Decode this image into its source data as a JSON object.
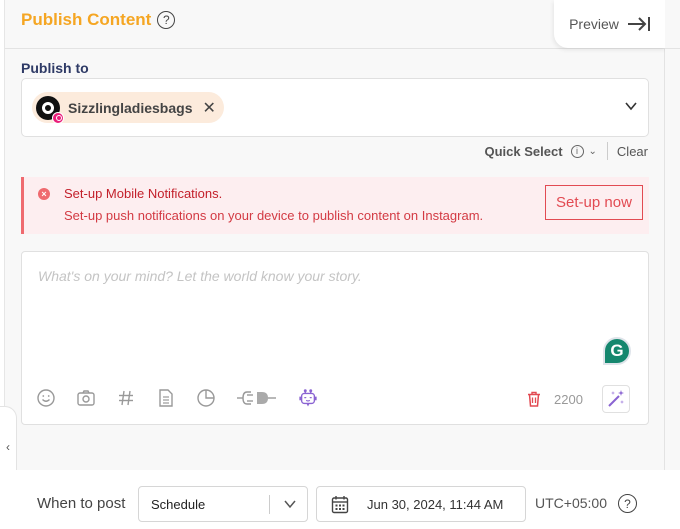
{
  "header": {
    "title": "Publish Content",
    "help_icon": "question-circle-icon",
    "preview_label": "Preview",
    "preview_icon": "arrow-to-right-icon"
  },
  "publish_to": {
    "label": "Publish to",
    "accounts": [
      {
        "name": "Sizzlingladiesbags",
        "platform": "Instagram",
        "remove_icon": "close-icon"
      }
    ],
    "dropdown_icon": "chevron-down-icon",
    "quick_select_label": "Quick Select",
    "quick_select_info_icon": "info-icon",
    "clear_label": "Clear"
  },
  "alert": {
    "title": "Set-up Mobile Notifications.",
    "description": "Set-up push notifications on your device to publish content on Instagram.",
    "button_label": "Set-up now",
    "icon": "error-circle-icon"
  },
  "editor": {
    "placeholder": "What's on your mind? Let the world know your story.",
    "value": "",
    "toolbar": [
      {
        "name": "emoji",
        "icon": "smiley-icon"
      },
      {
        "name": "media",
        "icon": "camera-icon"
      },
      {
        "name": "hashtag",
        "icon": "hashtag-icon"
      },
      {
        "name": "template",
        "icon": "document-icon"
      },
      {
        "name": "poll",
        "icon": "pie-chart-icon"
      },
      {
        "name": "integration",
        "icon": "plug-icon"
      },
      {
        "name": "ai-assistant",
        "icon": "robot-icon"
      }
    ],
    "char_remaining": "2200",
    "delete_icon": "trash-icon",
    "magic_icon": "magic-wand-icon",
    "grammarly_letter": "G"
  },
  "footer": {
    "when_label": "When to post",
    "schedule_value": "Schedule",
    "date_value": "Jun 30, 2024, 11:44 AM",
    "timezone": "UTC+05:00",
    "help_icon": "question-circle-icon"
  },
  "colors": {
    "title_accent": "#f5a623",
    "label_navy": "#2e3a66",
    "alert_red": "#e24a52",
    "alert_bg": "#fdeef0",
    "ai_purple": "#8a63d2",
    "grammarly_green": "#15876e",
    "instagram_pink": "#e91e7a"
  }
}
